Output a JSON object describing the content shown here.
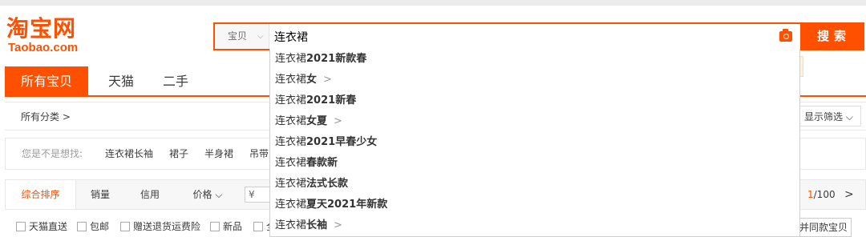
{
  "logo": {
    "cn": "淘宝网",
    "en": "Taobao.com"
  },
  "search": {
    "type_label": "宝贝",
    "type_chevron": "⌵",
    "query": "连衣裙",
    "placeholder": "",
    "button_label": "搜索",
    "camera_icon": "camera-icon"
  },
  "tabs": [
    {
      "label": "所有宝贝"
    },
    {
      "label": "天猫"
    },
    {
      "label": "二手"
    }
  ],
  "category": {
    "all_label": "所有分类 >",
    "filter_label": "显示筛选 ⌵"
  },
  "suggest": {
    "label": "您是不是想找:",
    "links": [
      "连衣裙长袖",
      "裙子",
      "半身裙",
      "吊带"
    ]
  },
  "sort": {
    "items": [
      "综合排序",
      "销量",
      "信用",
      "价格 ⌵"
    ],
    "price_placeholder": "¥",
    "pager_current": "1",
    "pager_total": "/100",
    "next": ">"
  },
  "checks": [
    "天猫直送",
    "包邮",
    "赠送退货运费险",
    "新品",
    "全"
  ],
  "same_button": "并同款宝贝",
  "dropdown": [
    {
      "prefix": "连衣裙",
      "suffix": "2021新款春",
      "arrow": ""
    },
    {
      "prefix": "连衣裙",
      "suffix": "女",
      "arrow": ">"
    },
    {
      "prefix": "连衣裙",
      "suffix": "2021新春",
      "arrow": ""
    },
    {
      "prefix": "连衣裙",
      "suffix": "女夏",
      "arrow": ">"
    },
    {
      "prefix": "连衣裙",
      "suffix": "2021早春少女",
      "arrow": ""
    },
    {
      "prefix": "连衣裙",
      "suffix": "春款新",
      "arrow": ""
    },
    {
      "prefix": "连衣裙",
      "suffix": "法式长款",
      "arrow": ""
    },
    {
      "prefix": "连衣裙",
      "suffix": "夏天2021年新款",
      "arrow": ""
    },
    {
      "prefix": "连衣裙",
      "suffix": "长袖",
      "arrow": ">"
    }
  ],
  "colors": {
    "brand": "#ff5000"
  }
}
